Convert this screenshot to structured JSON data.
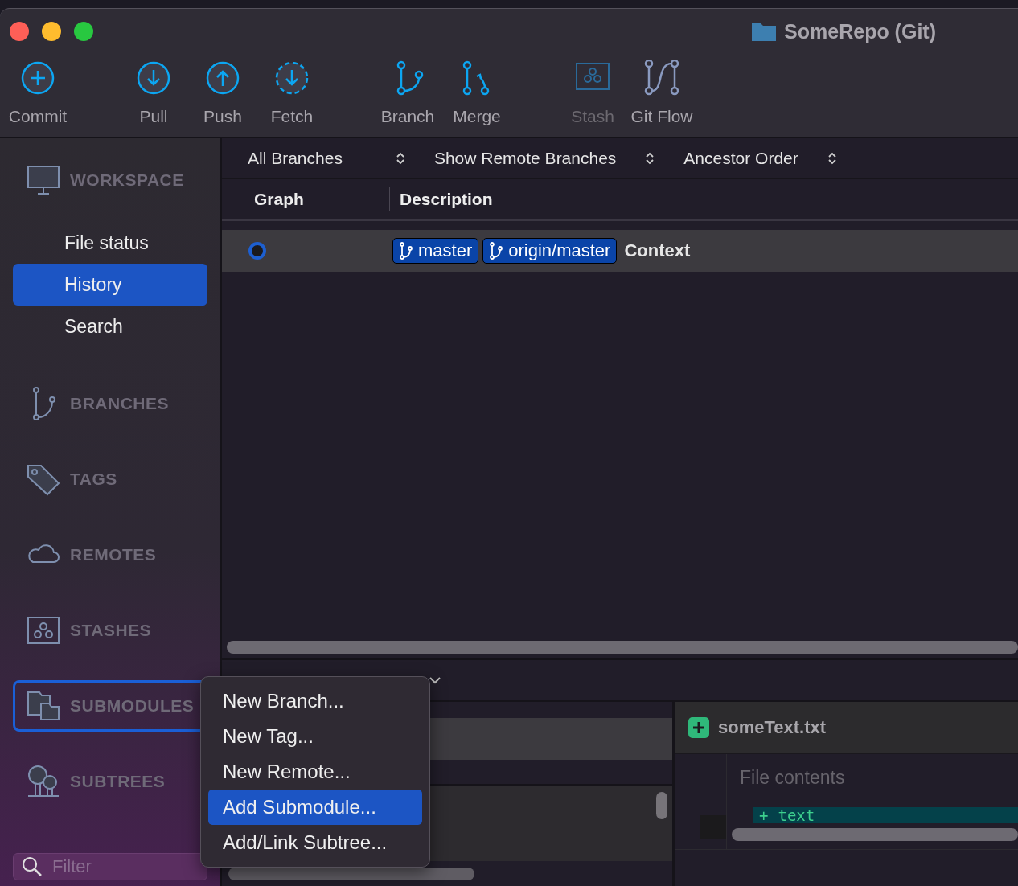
{
  "window": {
    "title": "SomeRepo (Git)"
  },
  "toolbar": {
    "groups": [
      [
        {
          "kind": "commit",
          "label": "Commit",
          "disabled": false
        }
      ],
      [
        {
          "kind": "pull",
          "label": "Pull",
          "disabled": false
        },
        {
          "kind": "push",
          "label": "Push",
          "disabled": false
        },
        {
          "kind": "fetch",
          "label": "Fetch",
          "disabled": false
        }
      ],
      [
        {
          "kind": "branch",
          "label": "Branch",
          "disabled": false
        },
        {
          "kind": "merge",
          "label": "Merge",
          "disabled": false
        }
      ],
      [
        {
          "kind": "stash",
          "label": "Stash",
          "disabled": true
        },
        {
          "kind": "gitflow",
          "label": "Git Flow",
          "disabled": false
        }
      ]
    ]
  },
  "sidebar": {
    "sections": [
      {
        "kind": "workspace",
        "label": "WORKSPACE",
        "focused": false,
        "items": [
          {
            "label": "File status",
            "selected": false
          },
          {
            "label": "History",
            "selected": true
          },
          {
            "label": "Search",
            "selected": false
          }
        ]
      },
      {
        "kind": "branches",
        "label": "BRANCHES",
        "focused": false
      },
      {
        "kind": "tags",
        "label": "TAGS",
        "focused": false
      },
      {
        "kind": "remotes",
        "label": "REMOTES",
        "focused": false
      },
      {
        "kind": "stashes",
        "label": "STASHES",
        "focused": false
      },
      {
        "kind": "submodules",
        "label": "SUBMODULES",
        "focused": true
      },
      {
        "kind": "subtrees",
        "label": "SUBTREES",
        "focused": false
      }
    ],
    "filter": {
      "placeholder": "Filter"
    }
  },
  "filters": [
    {
      "label": "All Branches"
    },
    {
      "label": "Show Remote Branches"
    },
    {
      "label": "Ancestor Order"
    }
  ],
  "history": {
    "columns": [
      "Graph",
      "Description"
    ],
    "rows": [
      {
        "selected": true,
        "refs": [
          "master",
          "origin/master"
        ],
        "message": "Context"
      }
    ]
  },
  "diff": {
    "file": "someText.txt",
    "section": "File contents",
    "lines": [
      {
        "sign": "+",
        "text": "text"
      }
    ]
  },
  "menu": {
    "items": [
      {
        "label": "New Branch...",
        "selected": false
      },
      {
        "label": "New Tag...",
        "selected": false
      },
      {
        "label": "New Remote...",
        "selected": false
      },
      {
        "label": "Add Submodule...",
        "selected": true
      },
      {
        "label": "Add/Link Subtree...",
        "selected": false
      }
    ]
  }
}
